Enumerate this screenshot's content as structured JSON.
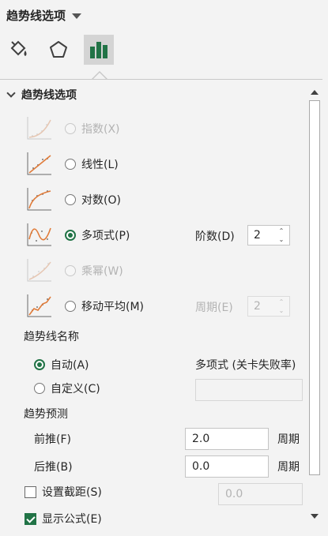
{
  "pane": {
    "title": "趋势线选项"
  },
  "tabs": [
    {
      "name": "fill-line-tab",
      "icon": "paint-bucket-icon"
    },
    {
      "name": "effects-tab",
      "icon": "pentagon-icon"
    },
    {
      "name": "trendline-options-tab",
      "icon": "bar-chart-icon",
      "active": true
    }
  ],
  "section": {
    "title": "趋势线选项"
  },
  "trend_types": [
    {
      "label": "指数(X)",
      "disabled": true,
      "checked": false
    },
    {
      "label": "线性(L)",
      "disabled": false,
      "checked": false
    },
    {
      "label": "对数(O)",
      "disabled": false,
      "checked": false
    },
    {
      "label": "多项式(P)",
      "disabled": false,
      "checked": true
    },
    {
      "label": "乘幂(W)",
      "disabled": true,
      "checked": false
    },
    {
      "label": "移动平均(M)",
      "disabled": false,
      "checked": false
    }
  ],
  "order": {
    "label": "阶数(D)",
    "value": "2"
  },
  "period": {
    "label": "周期(E)",
    "value": "2"
  },
  "trendline_name": {
    "heading": "趋势线名称",
    "auto_label": "自动(A)",
    "auto_value": "多项式 (关卡失败率)",
    "custom_label": "自定义(C)",
    "custom_value": ""
  },
  "forecast": {
    "heading": "趋势预测",
    "forward_label": "前推(F)",
    "forward_value": "2.0",
    "forward_unit": "周期",
    "backward_label": "后推(B)",
    "backward_value": "0.0",
    "backward_unit": "周期"
  },
  "intercept": {
    "label": "设置截距(S)",
    "value": "0.0",
    "checked": false
  },
  "show_equation": {
    "label": "显示公式(E)",
    "checked": true
  },
  "colors": {
    "accent": "#217346",
    "trend_line": "#e07b39"
  }
}
